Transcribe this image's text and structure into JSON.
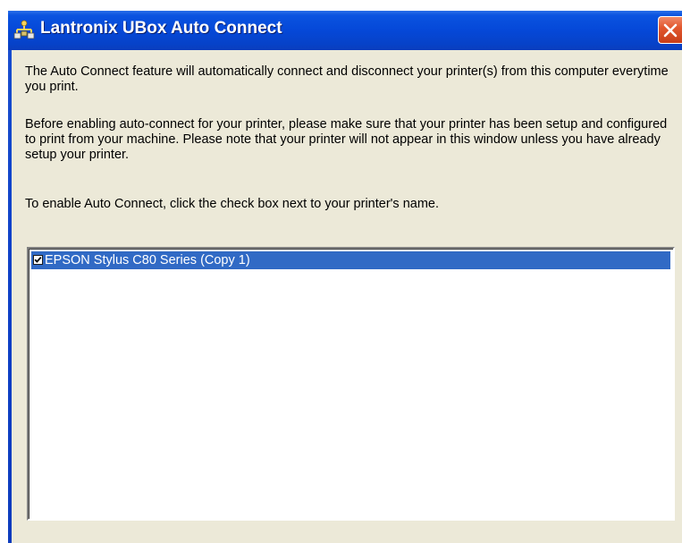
{
  "window": {
    "title": "Lantronix UBox Auto Connect",
    "title_icon": "printer-network-icon",
    "close_icon": "close-icon"
  },
  "content": {
    "paragraph1": "The Auto Connect feature will automatically connect and disconnect your printer(s) from this computer everytime you print.",
    "paragraph2": "Before enabling auto-connect for your printer, please make sure that your printer has been setup and configured to print from your machine.  Please note that your printer will not appear in this window unless you have already setup your printer.",
    "paragraph3": "To enable Auto Connect, click the check box next to your printer's name."
  },
  "printer_list": {
    "items": [
      {
        "label": "EPSON Stylus C80 Series (Copy 1)",
        "checked": true,
        "selected": true
      }
    ]
  },
  "colors": {
    "titlebar": "#0548d8",
    "client_bg": "#ece9d8",
    "selection": "#316ac5",
    "close_button": "#e2582f"
  }
}
